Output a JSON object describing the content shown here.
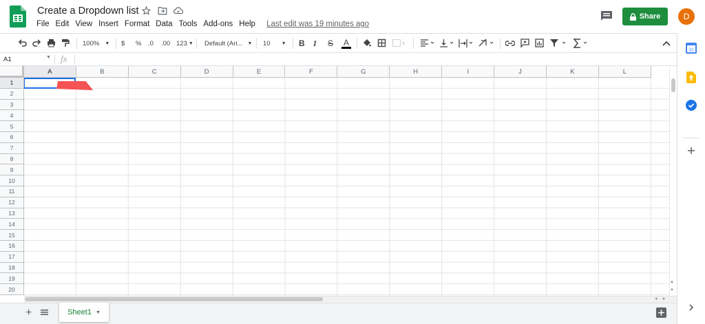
{
  "header": {
    "doc_title": "Create a Dropdown list",
    "menus": [
      "File",
      "Edit",
      "View",
      "Insert",
      "Format",
      "Data",
      "Tools",
      "Add-ons",
      "Help"
    ],
    "last_edit": "Last edit was 19 minutes ago",
    "share_label": "Share",
    "avatar_letter": "D"
  },
  "toolbar": {
    "zoom": "100%",
    "currency": "$",
    "percent": "%",
    "decimal_decrease": ".0",
    "decimal_increase": ".00",
    "more_formats": "123",
    "font": "Default (Ari...",
    "font_size": "10",
    "bold": "B",
    "italic": "I",
    "strikethrough": "S",
    "text_color": "A"
  },
  "formula_bar": {
    "name_box": "A1",
    "fx": "fx"
  },
  "grid": {
    "columns": [
      "A",
      "B",
      "C",
      "D",
      "E",
      "F",
      "G",
      "H",
      "I",
      "J",
      "K",
      "L"
    ],
    "rows": [
      "1",
      "2",
      "3",
      "4",
      "5",
      "6",
      "7",
      "8",
      "9",
      "10",
      "11",
      "12",
      "13",
      "14",
      "15",
      "16",
      "17",
      "18",
      "19",
      "20"
    ],
    "selected_cell": "A1"
  },
  "sheets": {
    "tabs": [
      "Sheet1"
    ]
  },
  "icons": {
    "logo": "sheets-logo-icon",
    "star": "star-icon",
    "move": "folder-move-icon",
    "cloud": "cloud-status-icon",
    "comments": "comment-icon"
  },
  "colors": {
    "share_green": "#1e8e3e",
    "selection_blue": "#1a73e8",
    "avatar_orange": "#e8710a",
    "arrow_red": "#f65355",
    "sheet_tab_green": "#188038"
  }
}
